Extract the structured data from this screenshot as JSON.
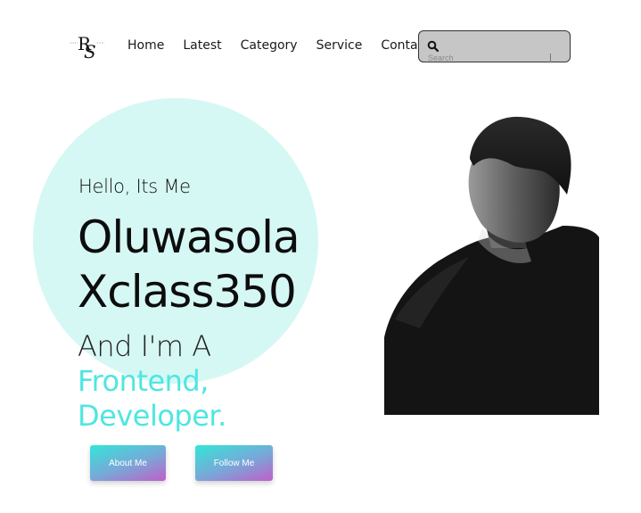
{
  "logo": {
    "initials": "RS"
  },
  "nav": {
    "items": [
      {
        "label": "Home"
      },
      {
        "label": "Latest"
      },
      {
        "label": "Category"
      },
      {
        "label": "Service"
      },
      {
        "label": "Contact"
      }
    ]
  },
  "search": {
    "placeholder": "Search",
    "icon": "search-icon"
  },
  "hero": {
    "greeting": "Hello, Its Me",
    "name_line1": "Oluwasola",
    "name_line2": "Xclass350",
    "role_lead": "And I'm A",
    "role_line1": "Frontend,",
    "role_line2": "Developer.",
    "accent_color": "#4fe6e0",
    "circle_color": "#d6f8f4"
  },
  "buttons": {
    "about_label": "About Me",
    "follow_label": "Follow Me"
  }
}
